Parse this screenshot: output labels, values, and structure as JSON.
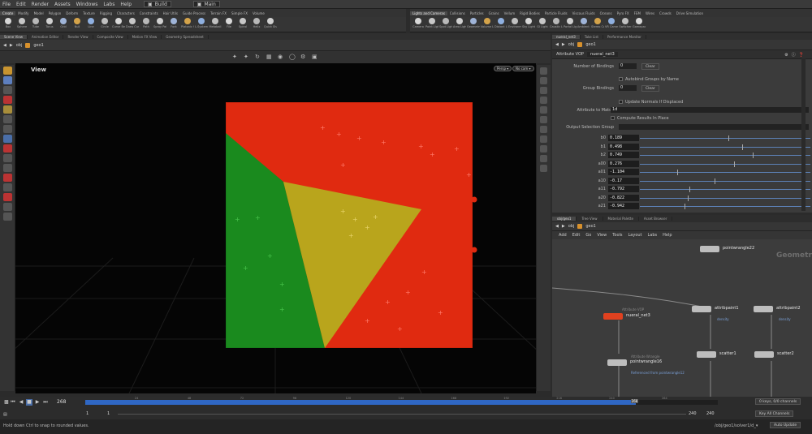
{
  "menubar": {
    "items": [
      "File",
      "Edit",
      "Render",
      "Assets",
      "Windows",
      "Labs",
      "Help"
    ],
    "build_selector": "Build",
    "desktop_selector": "Main"
  },
  "shelf_tabs_left": [
    "Create",
    "Modify",
    "Model",
    "Polygon",
    "Deform",
    "Texture",
    "Rigging",
    "Characters",
    "Constraints",
    "Hair Utils",
    "Guide Process",
    "Terrain FX",
    "Simple FX",
    "Volume"
  ],
  "shelf_tabs_right": [
    "Lights and Cameras",
    "Collisions",
    "Particles",
    "Grains",
    "Vellum",
    "Rigid Bodies",
    "Particle Fluids",
    "Viscous Fluids",
    "Oceans",
    "Pyro FX",
    "FEM",
    "Wires",
    "Crowds",
    "Drive Simulation"
  ],
  "shelf_tools_left": [
    "Box",
    "Sphere",
    "Tube",
    "Torus",
    "Grid",
    "Null",
    "Line",
    "Circle",
    "Curve Bezier",
    "Draw Curve",
    "Path",
    "Spray Paint",
    "Font",
    "Platonic Solids",
    "L-System",
    "Metaball",
    "File",
    "Spiral",
    "Helix",
    "Quick Shapes"
  ],
  "shelf_tools_right": [
    "Camera",
    "Point Light",
    "Spot Light",
    "Area Light",
    "Geometry Light",
    "Volume Light",
    "Distant Light",
    "Environment Light",
    "Sky Light",
    "GI Light",
    "Caustic Light",
    "Portal Light",
    "Ambient Light",
    "Stereo Camera",
    "VR Camera",
    "Switcher",
    "Gamepad Camera"
  ],
  "viewport_tabs": [
    "Scene View",
    "Animation Editor",
    "Render View",
    "Composite View",
    "Motion FX View",
    "Geometry Spreadsheet"
  ],
  "viewport_path": {
    "context": "obj",
    "node": "geo1"
  },
  "viewport": {
    "title": "View",
    "persp_label": "Persp ▾",
    "cam_label": "No cam ▾"
  },
  "params_tabs": [
    "nueral_net3",
    "Take List",
    "Performance Monitor"
  ],
  "params_path": {
    "context": "obj",
    "node": "geo1"
  },
  "params": {
    "node_type": "Attribute VOP",
    "node_name": "nueral_net3",
    "num_bindings_label": "Number of Bindings",
    "num_bindings_value": "0",
    "clear_label": "Clear",
    "autobind_label": "Autobind Groups by Name",
    "group_bindings_label": "Group Bindings",
    "group_bindings_value": "0",
    "update_normals_label": "Update Normals If Displaced",
    "attr_to_match_label": "Attribute to Match",
    "attr_to_match_value": "1d",
    "compute_in_place_label": "Compute Results In Place",
    "output_group_label": "Output Selection Group"
  },
  "sliders": [
    {
      "label": "b0",
      "value": "0.189",
      "pos": 0.52
    },
    {
      "label": "b1",
      "value": "0.498",
      "pos": 0.6
    },
    {
      "label": "b2",
      "value": "0.749",
      "pos": 0.66
    },
    {
      "label": "a00",
      "value": "0.276",
      "pos": 0.55
    },
    {
      "label": "a01",
      "value": "-1.104",
      "pos": 0.22
    },
    {
      "label": "a10",
      "value": "-0.17",
      "pos": 0.44
    },
    {
      "label": "a11",
      "value": "-0.792",
      "pos": 0.29
    },
    {
      "label": "a20",
      "value": "-0.822",
      "pos": 0.28
    },
    {
      "label": "a21",
      "value": "-0.942",
      "pos": 0.26
    }
  ],
  "network_tabs": [
    "obj/geo1",
    "Tree View",
    "Material Palette",
    "Asset Browser"
  ],
  "network_path": {
    "context": "obj",
    "node": "geo1"
  },
  "network_menu": [
    "Add",
    "Edit",
    "Go",
    "View",
    "Tools",
    "Layout",
    "Labs",
    "Help"
  ],
  "network": {
    "watermark": "Geometry",
    "nodes": [
      {
        "name": "pointwrangle22",
        "type": "",
        "sub": ""
      },
      {
        "name": "nueral_net3",
        "type": "Attribute VOP",
        "sub": ""
      },
      {
        "name": "attribpaint1",
        "type": "",
        "sub": "density"
      },
      {
        "name": "attribpaint2",
        "type": "",
        "sub": "density"
      },
      {
        "name": "scatter1",
        "type": "",
        "sub": ""
      },
      {
        "name": "scatter2",
        "type": "",
        "sub": ""
      },
      {
        "name": "pointwrangle16",
        "type": "Attribute Wrangle",
        "sub": "Referenced from pointwrangle12"
      }
    ]
  },
  "timeline": {
    "current_frame": "268",
    "frame_marker": "268",
    "ticks": [
      "24",
      "48",
      "72",
      "96",
      "120",
      "144",
      "168",
      "192",
      "216",
      "240",
      "264"
    ],
    "progress": 0.87,
    "range_start_a": "1",
    "range_start_b": "1",
    "range_end_a": "240",
    "range_end_b": "240",
    "keys_label": "0 keys, 0/0 channels",
    "key_all_label": "Key All Channels"
  },
  "status": {
    "hint": "Hold down Ctrl to snap to rounded values.",
    "path": "/obj/geo1/solver1/d_▾",
    "auto_update": "Auto Update"
  },
  "colors": {
    "red": "#e02a10",
    "green": "#1a8a1e",
    "yellow": "#b9a51c",
    "node_red": "#e0411f",
    "timeline_blue": "#2f67c4"
  }
}
